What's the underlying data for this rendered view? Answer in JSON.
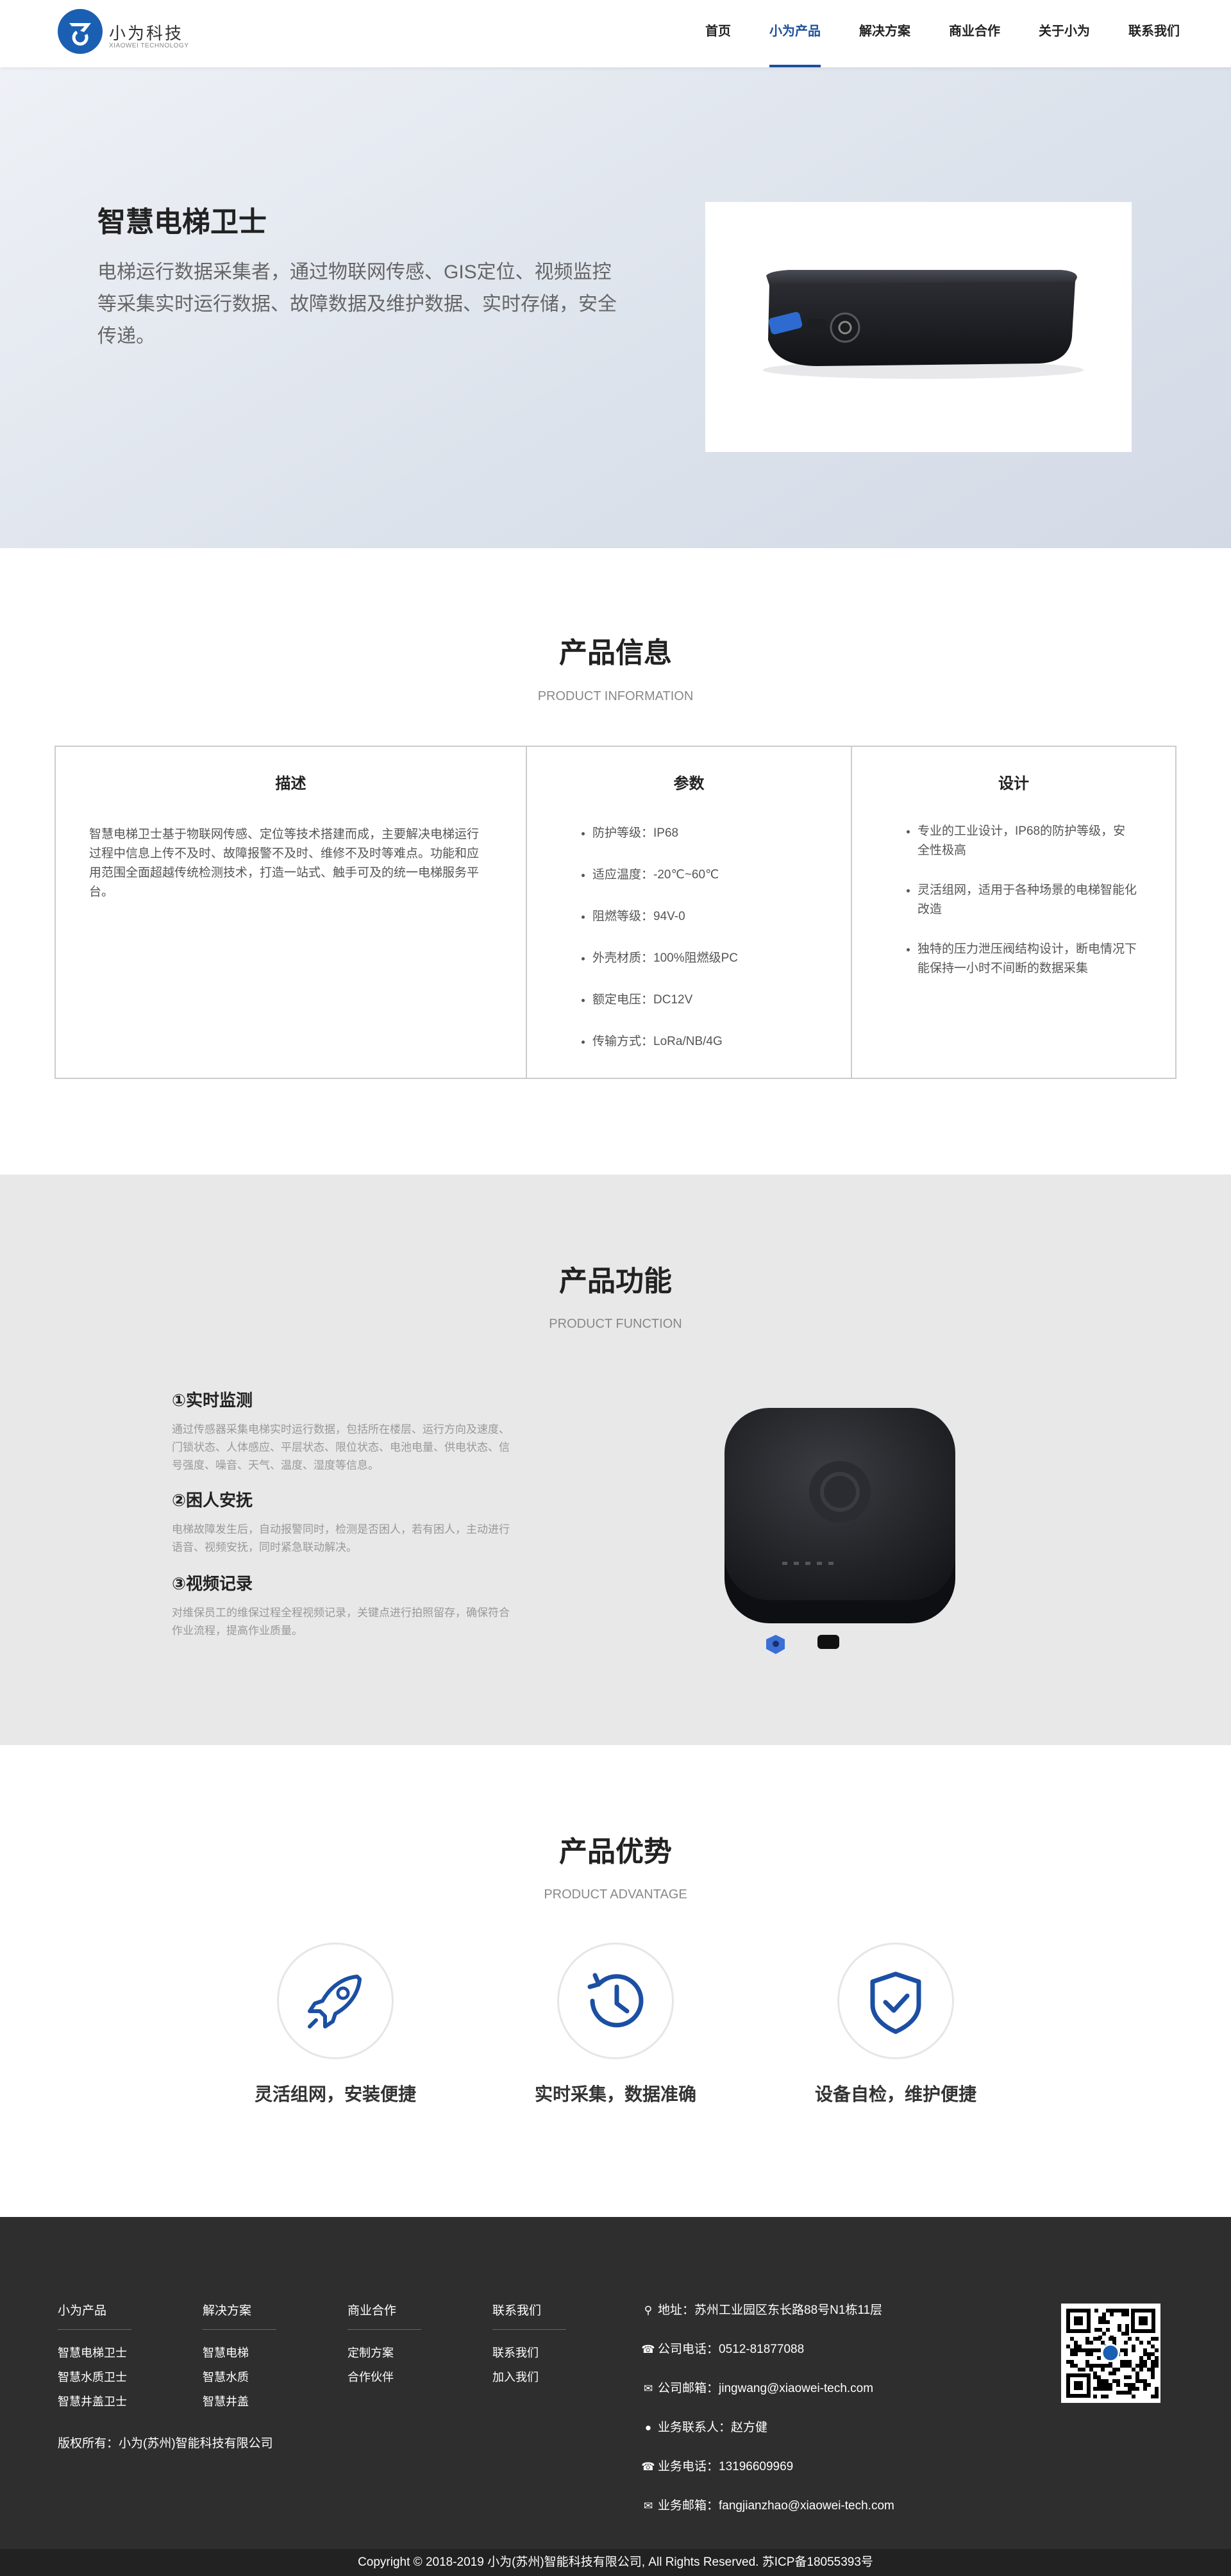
{
  "brand": {
    "name": "小为科技",
    "subtitle": "XIAOWEI TECHNOLOGY"
  },
  "nav": [
    {
      "label": "首页",
      "active": false
    },
    {
      "label": "小为产品",
      "active": true
    },
    {
      "label": "解决方案",
      "active": false
    },
    {
      "label": "商业合作",
      "active": false
    },
    {
      "label": "关于小为",
      "active": false
    },
    {
      "label": "联系我们",
      "active": false
    }
  ],
  "hero": {
    "title": "智慧电梯卫士",
    "description": "电梯运行数据采集者，通过物联网传感、GIS定位、视频监控等采集实时运行数据、故障数据及维护数据、实时存储，安全传递。"
  },
  "info": {
    "title": "产品信息",
    "subtitle": "PRODUCT INFORMATION",
    "desc_head": "描述",
    "desc_text": "智慧电梯卫士基于物联网传感、定位等技术搭建而成，主要解决电梯运行过程中信息上传不及时、故障报警不及时、维修不及时等难点。功能和应用范围全面超越传统检测技术，打造一站式、触手可及的统一电梯服务平台。",
    "param_head": "参数",
    "params": [
      {
        "key": "防护等级：",
        "value": "IP68"
      },
      {
        "key": "适应温度：",
        "value": "-20℃~60℃"
      },
      {
        "key": "阻燃等级：",
        "value": "94V-0"
      },
      {
        "key": "外壳材质：",
        "value": "100%阻燃级PC"
      },
      {
        "key": "额定电压：",
        "value": "DC12V"
      },
      {
        "key": "传输方式：",
        "value": "LoRa/NB/4G"
      }
    ],
    "design_head": "设计",
    "design": [
      "专业的工业设计，IP68的防护等级，安全性极高",
      "灵活组网，适用于各种场景的电梯智能化改造",
      "独特的压力泄压阀结构设计，断电情况下能保持一小时不间断的数据采集"
    ]
  },
  "function": {
    "title": "产品功能",
    "subtitle": "PRODUCT FUNCTION",
    "items": [
      {
        "title": "①实时监测",
        "text": "通过传感器采集电梯实时运行数据，包括所在楼层、运行方向及速度、门锁状态、人体感应、平层状态、限位状态、电池电量、供电状态、信号强度、噪音、天气、温度、湿度等信息。"
      },
      {
        "title": "②困人安抚",
        "text": "电梯故障发生后，自动报警同时，检测是否困人，若有困人，主动进行语音、视频安抚，同时紧急联动解决。"
      },
      {
        "title": "③视频记录",
        "text": "对维保员工的维保过程全程视频记录，关键点进行拍照留存，确保符合作业流程，提高作业质量。"
      }
    ]
  },
  "advantage": {
    "title": "产品优势",
    "subtitle": "PRODUCT ADVANTAGE",
    "items": [
      {
        "label": "灵活组网，安装便捷",
        "icon": "rocket-icon"
      },
      {
        "label": "实时采集，数据准确",
        "icon": "history-clock-icon"
      },
      {
        "label": "设备自检，维护便捷",
        "icon": "shield-check-icon"
      }
    ]
  },
  "footer": {
    "cols": [
      {
        "head": "小为产品",
        "links": [
          "智慧电梯卫士",
          "智慧水质卫士",
          "智慧井盖卫士"
        ]
      },
      {
        "head": "解决方案",
        "links": [
          "智慧电梯",
          "智慧水质",
          "智慧井盖"
        ]
      },
      {
        "head": "商业合作",
        "links": [
          "定制方案",
          "合作伙伴"
        ]
      },
      {
        "head": "联系我们",
        "links": [
          "联系我们",
          "加入我们"
        ]
      }
    ],
    "copyright_owner": "版权所有：小为(苏州)智能科技有限公司",
    "contacts": [
      {
        "icon": "location-pin-icon",
        "glyph": "⚲",
        "label": "地址：",
        "value": "苏州工业园区东长路88号N1栋11层"
      },
      {
        "icon": "phone-icon",
        "glyph": "☎",
        "label": "公司电话：",
        "value": "0512-81877088"
      },
      {
        "icon": "mail-icon",
        "glyph": "✉",
        "label": "公司邮箱：",
        "value": "jingwang@xiaowei-tech.com"
      },
      {
        "icon": "user-icon",
        "glyph": "●",
        "label": "业务联系人：",
        "value": "赵方健"
      },
      {
        "icon": "phone-icon",
        "glyph": "☎",
        "label": "业务电话：",
        "value": "13196609969"
      },
      {
        "icon": "mail-icon",
        "glyph": "✉",
        "label": "业务邮箱：",
        "value": "fangjianzhao@xiaowei-tech.com"
      }
    ],
    "bottom": "Copyright © 2018-2019 小为(苏州)智能科技有限公司, All Rights Reserved.    苏ICP备18055393号"
  }
}
